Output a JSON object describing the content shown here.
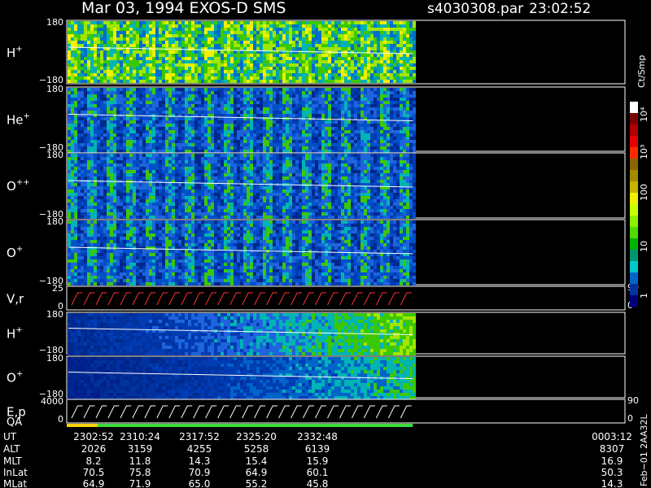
{
  "header": {
    "title": "Mar 03, 1994   EXOS-D SMS",
    "file": "s4030308.par",
    "time": "23:02:52"
  },
  "chart_data": {
    "type": "heatmap",
    "title": "Mar 03, 1994   EXOS-D SMS",
    "panels": [
      {
        "label": "H",
        "sup": "+",
        "ymax": "180",
        "ymin": "−180",
        "kind": "spectrogram"
      },
      {
        "label": "He",
        "sup": "+",
        "ymax": "180",
        "ymin": "−180",
        "kind": "spectrogram"
      },
      {
        "label": "O",
        "sup": "++",
        "ymax": "180",
        "ymin": "−180",
        "kind": "spectrogram"
      },
      {
        "label": "O",
        "sup": "+",
        "ymax": "180",
        "ymin": "−180",
        "kind": "spectrogram"
      },
      {
        "label": "V,r",
        "sup": "",
        "ymax": "25",
        "ymin": "0",
        "rmax": "90",
        "rmin": "0",
        "kind": "line"
      },
      {
        "label": "H",
        "sup": "+",
        "ymax": "180",
        "ymin": "−180",
        "kind": "spectrogram"
      },
      {
        "label": "O",
        "sup": "+",
        "ymax": "180",
        "ymin": "−180",
        "kind": "spectrogram"
      },
      {
        "label": "E,p",
        "sup": "",
        "ymax": "4000",
        "ymin": "0",
        "rmax": "90",
        "rmin": "0",
        "kind": "line"
      }
    ],
    "qa_label": "QA",
    "colorbar": {
      "unit": "Ct/Smp",
      "ticks": [
        "10^4",
        "10^3",
        "100",
        "10",
        "1"
      ],
      "colors": [
        "#ffffff",
        "#7a0000",
        "#b30000",
        "#e60000",
        "#ff2a00",
        "#8c6400",
        "#a08c00",
        "#c8b400",
        "#f0f000",
        "#c8ff00",
        "#8cf000",
        "#50dc00",
        "#00b400",
        "#00966e",
        "#00c8c8",
        "#0064c8",
        "#0032a0",
        "#000078"
      ]
    },
    "time_axis": {
      "row_labels": [
        "UT",
        "ALT",
        "MLT",
        "InLat",
        "MLat"
      ],
      "columns": [
        {
          "UT": "2302:52",
          "ALT": "2026",
          "MLT": "8.2",
          "InLat": "70.5",
          "MLat": "64.9"
        },
        {
          "UT": "2310:24",
          "ALT": "3159",
          "MLT": "11.8",
          "InLat": "75.8",
          "MLat": "71.9"
        },
        {
          "UT": "2317:52",
          "ALT": "4255",
          "MLT": "14.3",
          "InLat": "70.9",
          "MLat": "65.0"
        },
        {
          "UT": "2325:20",
          "ALT": "5258",
          "MLT": "15.4",
          "InLat": "64.9",
          "MLat": "55.2"
        },
        {
          "UT": "2332:48",
          "ALT": "6139",
          "MLT": "15.9",
          "InLat": "60.1",
          "MLat": "45.8"
        },
        {
          "UT": "0003:12",
          "ALT": "8307",
          "MLT": "16.9",
          "InLat": "50.3",
          "MLat": "14.3"
        }
      ]
    },
    "data_coverage_fraction": 0.62
  },
  "footer": {
    "stamp": "Feb−01 2AA32L"
  }
}
